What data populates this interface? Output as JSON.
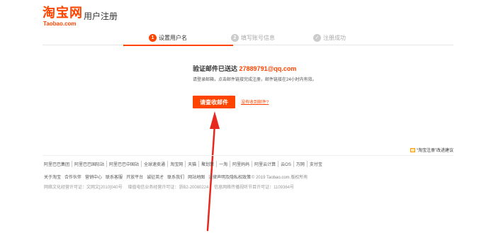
{
  "header": {
    "logo_main": "淘宝网",
    "logo_sub": "Taobao.com",
    "title": "用户注册"
  },
  "steps": [
    {
      "num": "1",
      "label": "设置用户名",
      "state": "active"
    },
    {
      "num": "2",
      "label": "填写账号信息",
      "state": "todo"
    },
    {
      "num": "✓",
      "label": "注册成功",
      "state": "todo"
    }
  ],
  "main": {
    "verify_prefix": "验证邮件已送达",
    "email": "27889791@qq.com",
    "hint": "请登录邮箱，点击邮件链接完成注册，邮件链接在24小时内有效。",
    "check_button": "请查收邮件",
    "not_received": "没有收到邮件?"
  },
  "feedback": "“淘宝注册”改进建议",
  "footer": {
    "links": [
      "阿里巴巴集团",
      "阿里巴巴国际站",
      "阿里巴巴中国站",
      "全球速卖通",
      "淘宝网",
      "天猫",
      "聚划算",
      "一淘",
      "阿里妈妈",
      "阿里云计算",
      "云OS",
      "万网",
      "支付宝"
    ],
    "row2_links": [
      "关于淘宝",
      "合作伙伴",
      "营销中心",
      "联系客服",
      "开放平台",
      "诚征英才",
      "联系我们",
      "网站地图",
      "法律声明及隐私权政策"
    ],
    "copyright": "© 2019 Taobao.com 版权所有",
    "row3": [
      "网络文化经营许可证：文网文[2010]040号",
      "增值电信业务经营许可证：浙B2-20080224",
      "信息网络传播视听节目许可证：1109364号"
    ]
  },
  "colors": {
    "brand": "#ff4400",
    "annotation": "#e8281e"
  }
}
